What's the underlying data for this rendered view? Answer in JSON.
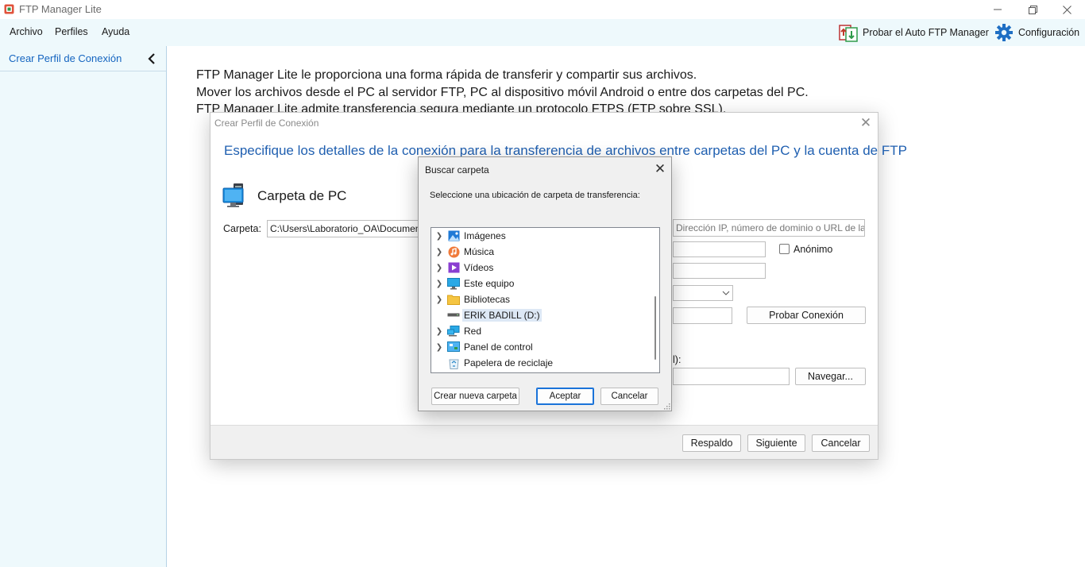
{
  "window": {
    "title": "FTP Manager Lite",
    "accent": "#e0533c"
  },
  "menu": {
    "items": [
      "Archivo",
      "Perfiles",
      "Ayuda"
    ],
    "auto_ftp_label": "Probar el Auto FTP Manager",
    "settings_label": "Configuración"
  },
  "sidebar": {
    "item_label": "Crear Perfil de Conexión",
    "background": "#eef9fc"
  },
  "intro": {
    "lines": [
      "FTP Manager Lite le proporciona una forma rápida de transferir y compartir sus archivos.",
      "Mover los archivos desde el PC al servidor FTP, PC al dispositivo móvil Android o entre dos carpetas del PC.",
      "FTP Manager Lite admite transferencia segura mediante un protocolo FTPS (FTP sobre SSL)."
    ]
  },
  "profile_dialog": {
    "title": "Crear Perfil de Conexión",
    "heading": "Especifique los detalles de la conexión para la transferencia de archivos entre carpetas del PC y la cuenta de FTP",
    "pc_section_title": "Carpeta de PC",
    "folder_label": "Carpeta:",
    "folder_value": "C:\\Users\\Laboratorio_OA\\Documentos",
    "host_placeholder": "Dirección IP, número de dominio o URL de la FTP",
    "anonymous_label": "Anónimo",
    "test_connection_label": "Probar Conexión",
    "remote_folder_label_tail": "l):",
    "browse_label": "Navegar...",
    "backup_label": "Respaldo",
    "next_label": "Siguiente",
    "cancel_label": "Cancelar"
  },
  "browse_dialog": {
    "title": "Buscar carpeta",
    "instruction": "Seleccione una ubicación de carpeta de transferencia:",
    "tree": [
      {
        "label": "Imágenes",
        "icon": "pictures-icon",
        "expandable": true,
        "selected": false
      },
      {
        "label": "Música",
        "icon": "music-icon",
        "expandable": true,
        "selected": false
      },
      {
        "label": "Vídeos",
        "icon": "videos-icon",
        "expandable": true,
        "selected": false
      },
      {
        "label": "Este equipo",
        "icon": "computer-icon",
        "expandable": true,
        "selected": false
      },
      {
        "label": "Bibliotecas",
        "icon": "libraries-icon",
        "expandable": true,
        "selected": false
      },
      {
        "label": "ERIK BADILL (D:)",
        "icon": "drive-icon",
        "expandable": false,
        "selected": true
      },
      {
        "label": "Red",
        "icon": "network-icon",
        "expandable": true,
        "selected": false
      },
      {
        "label": "Panel de control",
        "icon": "control-panel-icon",
        "expandable": true,
        "selected": false
      },
      {
        "label": "Papelera de reciclaje",
        "icon": "recycle-bin-icon",
        "expandable": false,
        "selected": false
      }
    ],
    "new_folder_label": "Crear nueva carpeta",
    "ok_label": "Aceptar",
    "cancel_label": "Cancelar"
  }
}
